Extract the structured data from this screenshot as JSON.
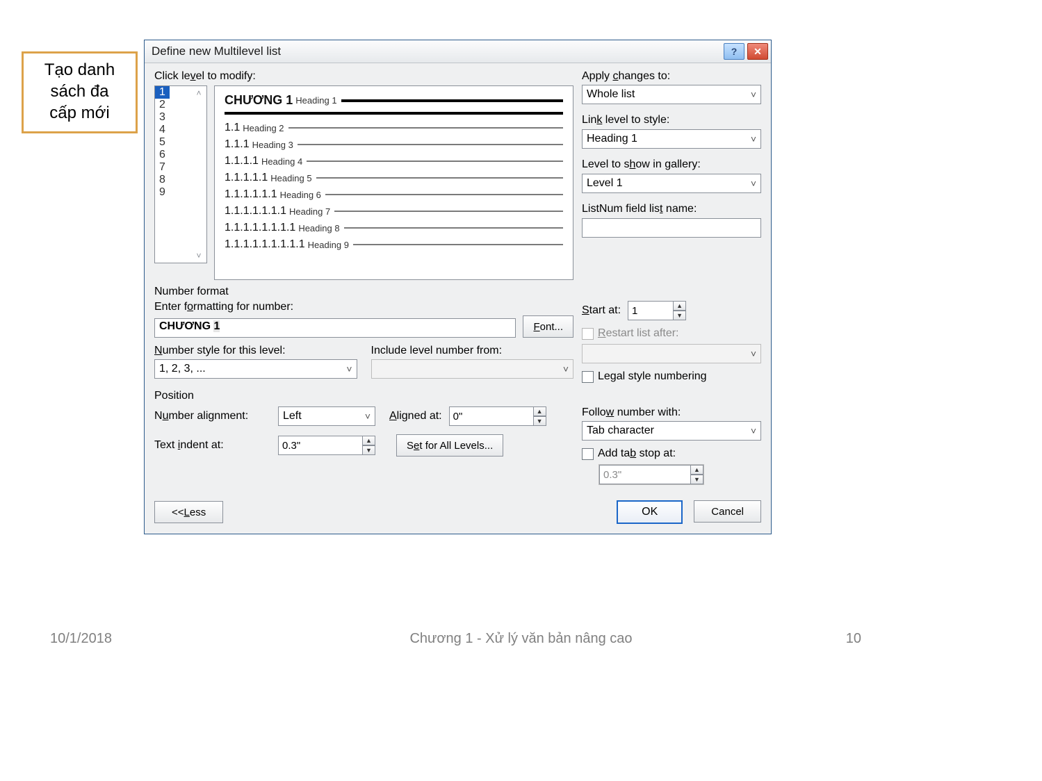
{
  "callout": {
    "line1": "Tạo danh",
    "line2": "sách đa",
    "line3": "cấp mới"
  },
  "dialog": {
    "title": "Define new Multilevel list",
    "clickLevelLabel": "Click level to modify:",
    "levels": [
      "1",
      "2",
      "3",
      "4",
      "5",
      "6",
      "7",
      "8",
      "9"
    ],
    "preview": {
      "l1_num": "CHƯƠNG 1",
      "l1_head": "Heading 1",
      "l2_num": "1.1",
      "l2_head": "Heading 2",
      "l3_num": "1.1.1",
      "l3_head": "Heading 3",
      "l4_num": "1.1.1.1",
      "l4_head": "Heading 4",
      "l5_num": "1.1.1.1.1",
      "l5_head": "Heading 5",
      "l6_num": "1.1.1.1.1.1",
      "l6_head": "Heading 6",
      "l7_num": "1.1.1.1.1.1.1",
      "l7_head": "Heading 7",
      "l8_num": "1.1.1.1.1.1.1.1",
      "l8_head": "Heading 8",
      "l9_num": "1.1.1.1.1.1.1.1.1",
      "l9_head": "Heading 9"
    },
    "applyChangesLabel": "Apply changes to:",
    "applyChangesValue": "Whole list",
    "linkLevelLabel": "Link level to style:",
    "linkLevelValue": "Heading 1",
    "levelShowLabel": "Level to show in gallery:",
    "levelShowValue": "Level 1",
    "listnumLabel": "ListNum field list name:",
    "listnumValue": "",
    "numberFormatLabel": "Number format",
    "enterFormattingLabel": "Enter formatting for number:",
    "formattingPrefix": "CHƯƠNG ",
    "formattingNum": "1",
    "fontBtn": "Font...",
    "numberStyleLabel": "Number style for this level:",
    "numberStyleValue": "1, 2, 3, ...",
    "includeLevelLabel": "Include level number from:",
    "startAtLabel": "Start at:",
    "startAtValue": "1",
    "restartLabel": "Restart list after:",
    "legalLabel": "Legal style numbering",
    "positionLabel": "Position",
    "numAlignLabel": "Number alignment:",
    "numAlignValue": "Left",
    "alignedAtLabel": "Aligned at:",
    "alignedAtValue": "0\"",
    "textIndentLabel": "Text indent at:",
    "textIndentValue": "0.3\"",
    "setAllBtn": "Set for All Levels...",
    "followLabel": "Follow number with:",
    "followValue": "Tab character",
    "addTabLabel": "Add tab stop at:",
    "addTabValue": "0.3\"",
    "lessBtn": "<< Less",
    "okBtn": "OK",
    "cancelBtn": "Cancel"
  },
  "footer": {
    "date": "10/1/2018",
    "center": "Chương 1 - Xử lý văn bản nâng cao",
    "page": "10"
  }
}
